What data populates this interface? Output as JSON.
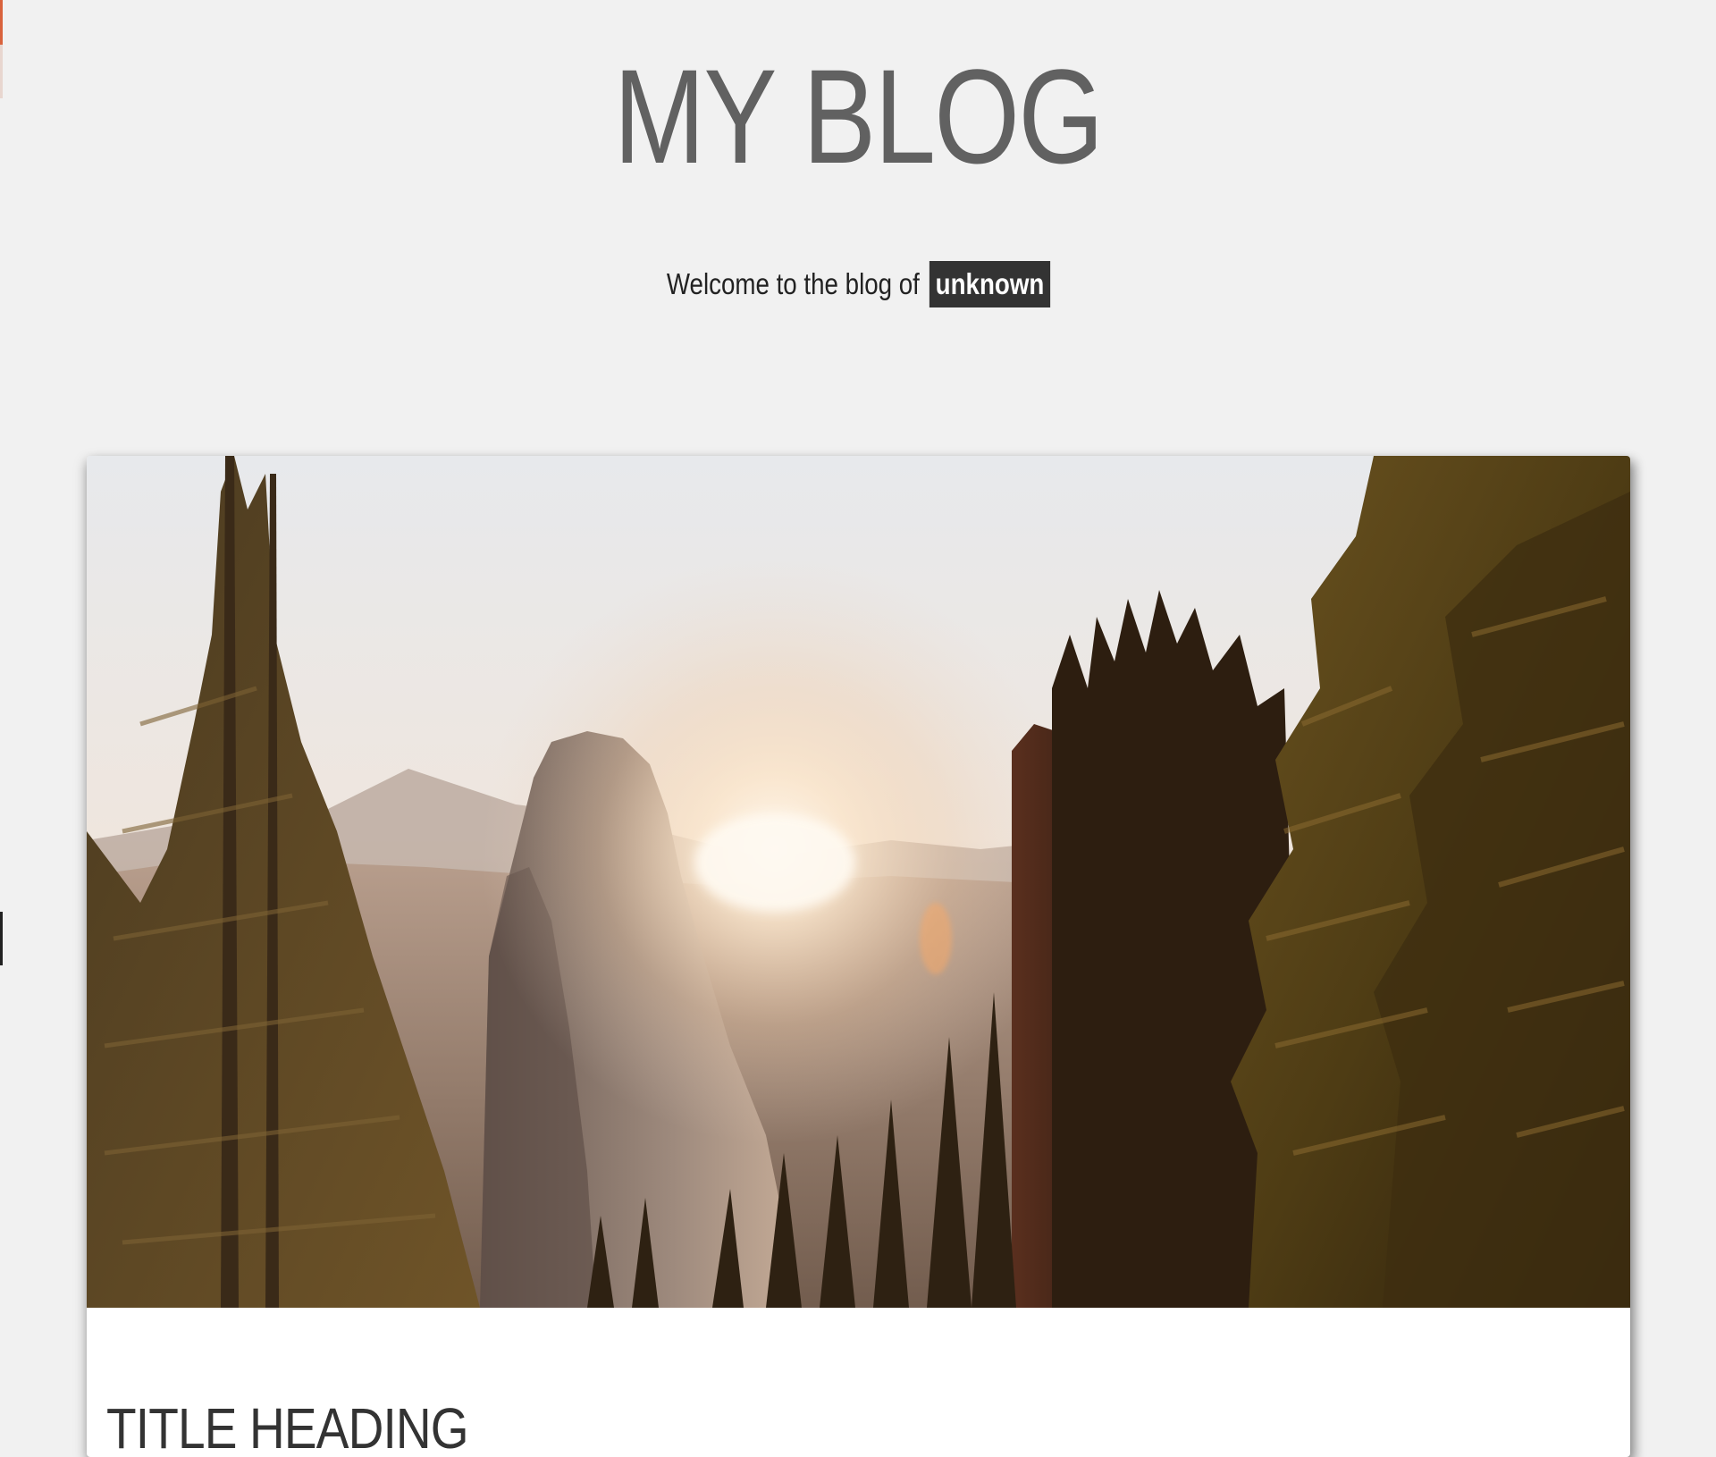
{
  "header": {
    "title": "MY BLOG",
    "welcome_text": "Welcome to the blog of",
    "author": "unknown"
  },
  "post": {
    "image_alt": "Mountain valley with pine trees at sunrise",
    "title": "TITLE HEADING"
  },
  "colors": {
    "page_background": "#f1f1f1",
    "title_color": "#616161",
    "badge_background": "#333333",
    "badge_text": "#ffffff"
  }
}
